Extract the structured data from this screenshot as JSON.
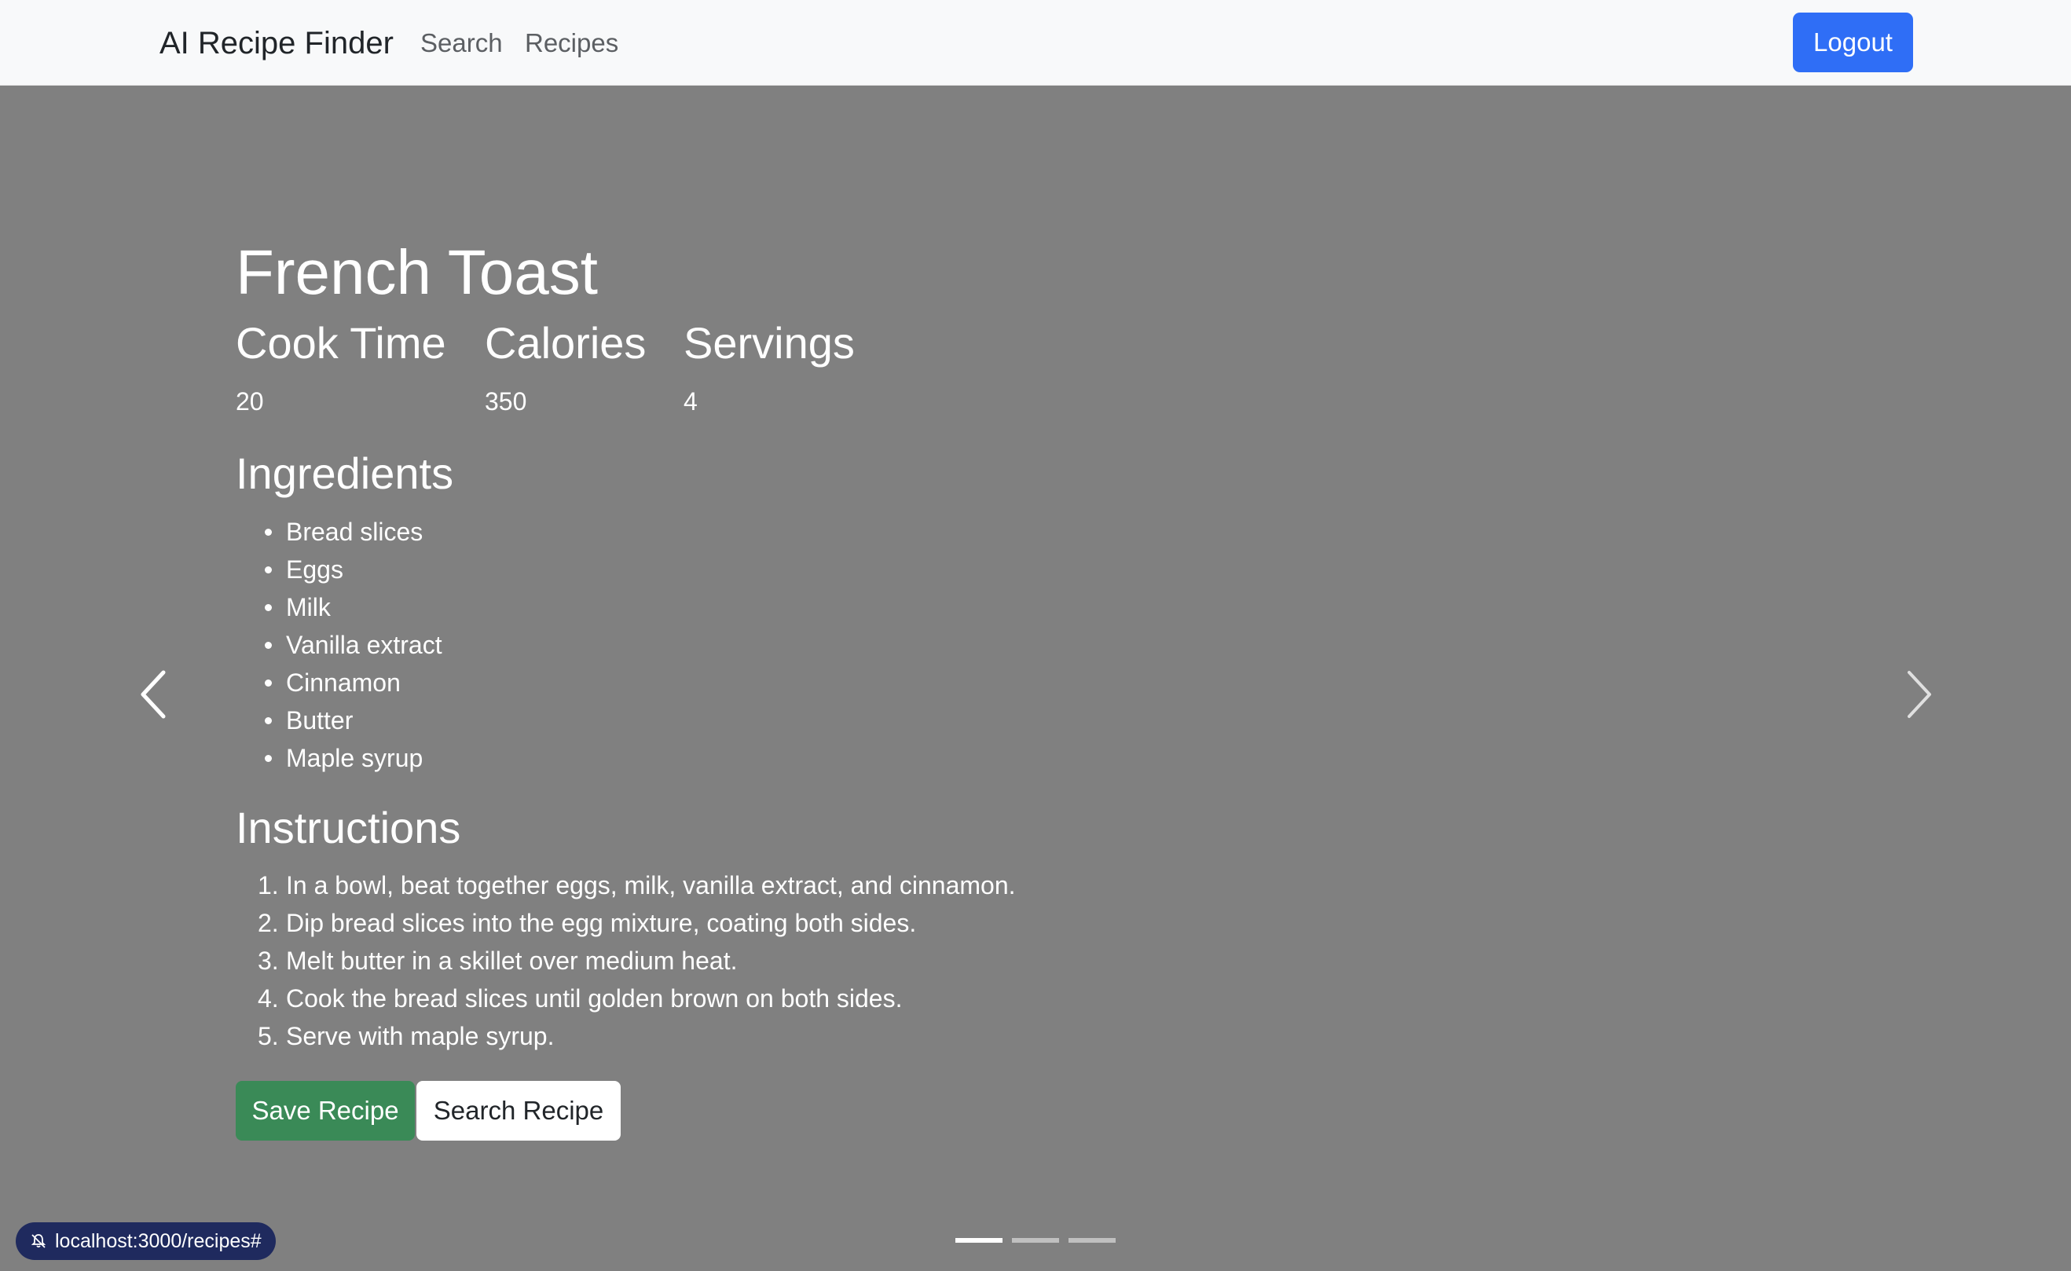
{
  "navbar": {
    "brand": "AI Recipe Finder",
    "links": [
      {
        "label": "Search"
      },
      {
        "label": "Recipes"
      }
    ],
    "logout_label": "Logout",
    "accent_color": "#2f6ef6"
  },
  "recipe": {
    "title": "French Toast",
    "stats": {
      "cook_time_label": "Cook Time",
      "cook_time_value": "20",
      "calories_label": "Calories",
      "calories_value": "350",
      "servings_label": "Servings",
      "servings_value": "4"
    },
    "ingredients_heading": "Ingredients",
    "ingredients": [
      "Bread slices",
      "Eggs",
      "Milk",
      "Vanilla extract",
      "Cinnamon",
      "Butter",
      "Maple syrup"
    ],
    "instructions_heading": "Instructions",
    "instructions": [
      "In a bowl, beat together eggs, milk, vanilla extract, and cinnamon.",
      "Dip bread slices into the egg mixture, coating both sides.",
      "Melt butter in a skillet over medium heat.",
      "Cook the bread slices until golden brown on both sides.",
      "Serve with maple syrup."
    ],
    "instruction_numbers": [
      "1.",
      "2.",
      "3.",
      "4.",
      "5."
    ]
  },
  "actions": {
    "save_label": "Save Recipe",
    "search_label": "Search Recipe",
    "save_color": "#3a8a57"
  },
  "carousel": {
    "slide_count": 3,
    "active_slide": 1,
    "prev_icon": "chevron-left-icon",
    "next_icon": "chevron-right-icon"
  },
  "status_bar": {
    "url": "localhost:3000/recipes#"
  }
}
